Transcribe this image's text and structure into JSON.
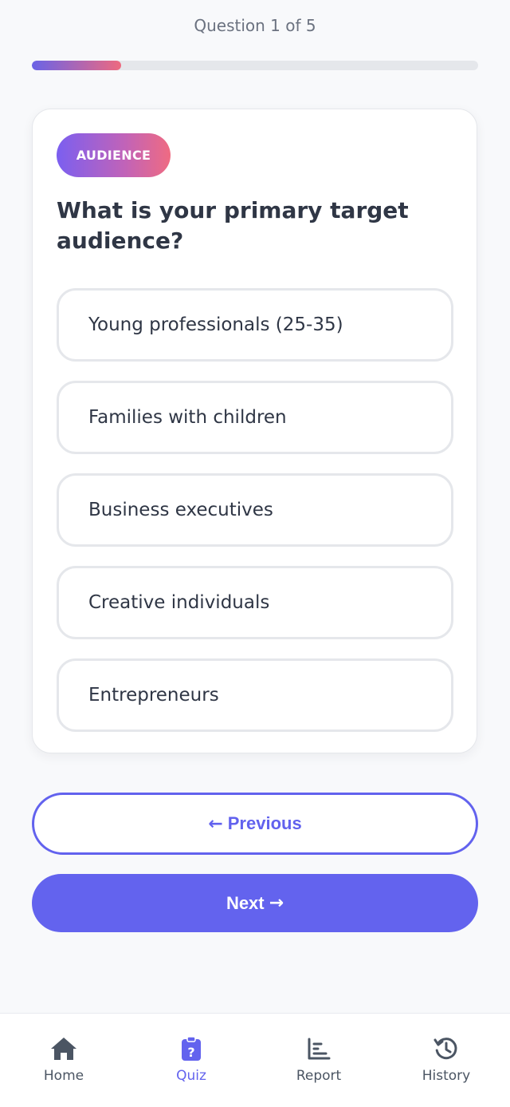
{
  "progress": {
    "label": "Question 1 of 5",
    "current": 1,
    "total": 5,
    "fraction": 0.2
  },
  "card": {
    "category": "AUDIENCE",
    "question": "What is your primary target audience?",
    "options": [
      {
        "label": "Young professionals (25-35)"
      },
      {
        "label": "Families with children"
      },
      {
        "label": "Business executives"
      },
      {
        "label": "Creative individuals"
      },
      {
        "label": "Entrepreneurs"
      }
    ]
  },
  "buttons": {
    "previous_label": "Previous",
    "next_label": "Next"
  },
  "nav": {
    "items": [
      {
        "label": "Home",
        "icon": "home-icon",
        "active": false
      },
      {
        "label": "Quiz",
        "icon": "quiz-icon",
        "active": true
      },
      {
        "label": "Report",
        "icon": "report-icon",
        "active": false
      },
      {
        "label": "History",
        "icon": "history-icon",
        "active": false
      }
    ]
  },
  "colors": {
    "accent": "#6363ee",
    "gradient_start": "#6a63e6",
    "gradient_end": "#ee6a7f",
    "text": "#2f3645",
    "muted": "#6b7280"
  }
}
